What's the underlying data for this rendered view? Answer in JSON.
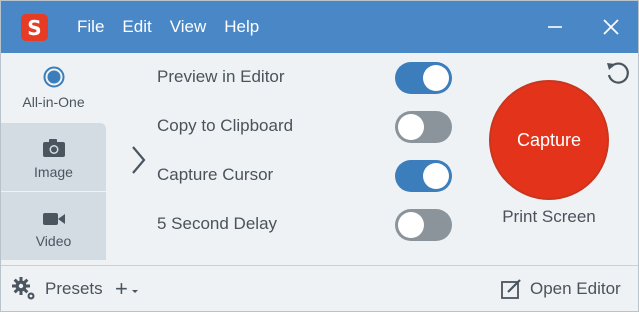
{
  "app": {
    "logo_letter": "S",
    "brand_color": "#e63b24",
    "titlebar_color": "#4a87c6"
  },
  "menu": {
    "items": [
      "File",
      "Edit",
      "View",
      "Help"
    ]
  },
  "window_controls": {
    "minimize_icon": "minimize-icon",
    "close_icon": "close-icon"
  },
  "tabs": [
    {
      "label": "All-in-One",
      "icon": "all-in-one-radio-icon",
      "selected": true
    },
    {
      "label": "Image",
      "icon": "camera-icon",
      "selected": false
    },
    {
      "label": "Video",
      "icon": "video-camera-icon",
      "selected": false
    }
  ],
  "options": [
    {
      "label": "Preview in Editor",
      "enabled": true
    },
    {
      "label": "Copy to Clipboard",
      "enabled": false
    },
    {
      "label": "Capture Cursor",
      "enabled": true
    },
    {
      "label": "5 Second Delay",
      "enabled": false
    }
  ],
  "capture": {
    "label": "Capture",
    "hotkey": "Print Screen",
    "color": "#e3341b"
  },
  "footer": {
    "presets_label": "Presets",
    "add_label": "+",
    "open_editor_label": "Open Editor"
  }
}
